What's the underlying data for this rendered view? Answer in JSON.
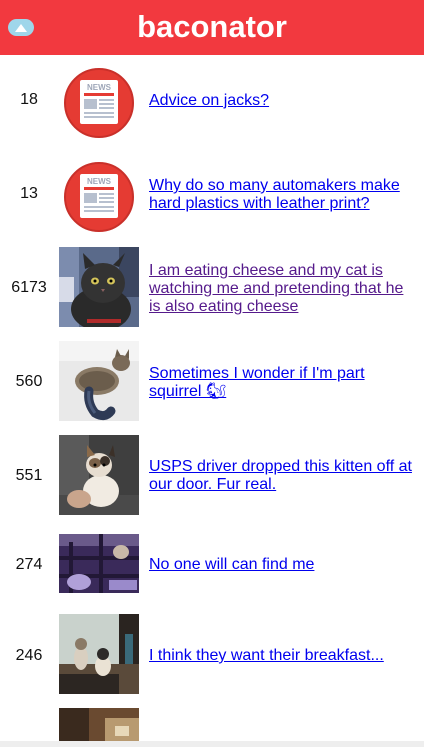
{
  "header": {
    "title": "baconator",
    "toggle_icon": "chevron-up-icon",
    "background_color": "#f2393f",
    "toggle_color": "#9fd6ea"
  },
  "posts": [
    {
      "score": "18",
      "title": "Advice on jacks?",
      "thumbnail": "news-icon",
      "visited": false
    },
    {
      "score": "13",
      "title": "Why do so many automakers make hard plastics with leather print?",
      "thumbnail": "news-icon",
      "visited": false
    },
    {
      "score": "6173",
      "title": "I am eating cheese and my cat is watching me and pretending that he is also eating cheese",
      "thumbnail": "cat-photo",
      "visited": true
    },
    {
      "score": "560",
      "title": "Sometimes I wonder if I'm part squirrel 🐿",
      "thumbnail": "cat-photo",
      "visited": false
    },
    {
      "score": "551",
      "title": "USPS driver dropped this kitten off at our door. Fur real.",
      "thumbnail": "kitten-photo",
      "visited": false
    },
    {
      "score": "274",
      "title": "No one will can find me",
      "thumbnail": "cat-photo",
      "visited": false
    },
    {
      "score": "246",
      "title": "I think they want their breakfast...",
      "thumbnail": "cat-photo",
      "visited": false
    }
  ],
  "colors": {
    "link": "#0000ee",
    "visited_link": "#551a8b"
  }
}
